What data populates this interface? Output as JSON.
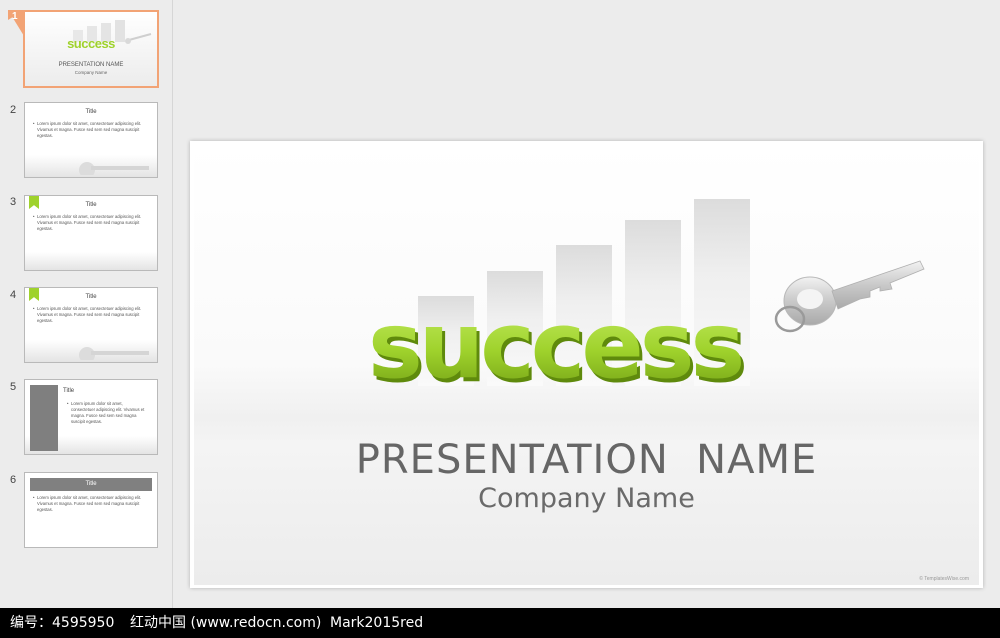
{
  "thumbnails": [
    {
      "number": "1",
      "title": "PRESENTATION  NAME",
      "subtitle": "Company Name",
      "logo": "success"
    },
    {
      "number": "2",
      "title": "Title",
      "body": "Lorem ipsum dolor sit amet, consectetuer adipiscing elit. Vivamus et magna. Fusce sed sem sed magna suscipit egestas."
    },
    {
      "number": "3",
      "title": "Title",
      "body": "Lorem ipsum dolor sit amet, consectetuer adipiscing elit. Vivamus et magna. Fusce sed sem sed magna suscipit egestas."
    },
    {
      "number": "4",
      "title": "Title",
      "body": "Lorem ipsum dolor sit amet, consectetuer adipiscing elit. Vivamus et magna. Fusce sed sem sed magna suscipit egestas."
    },
    {
      "number": "5",
      "title": "Title",
      "body": "Lorem ipsum dolor sit amet, consectetuer adipiscing elit. Vivamus et magna. Fusce sed sem sed magna suscipit egestas."
    },
    {
      "number": "6",
      "title": "Title",
      "body": "Lorem ipsum dolor sit amet, consectetuer adipiscing elit. Vivamus et magna. Fusce sed sem sed magna suscipit egestas."
    }
  ],
  "slide": {
    "logo_text": "success",
    "title": "PRESENTATION  NAME",
    "company": "Company Name",
    "credit": "© TemplatesWise.com"
  },
  "caption": {
    "id_text": "编号：4595950",
    "site_text": "红动中国 (www.redocn.com)",
    "author_text": "Mark2015red"
  },
  "colors": {
    "accent_green": "#9fd22c",
    "selection_orange": "#f2a375",
    "title_gray": "#666666"
  }
}
